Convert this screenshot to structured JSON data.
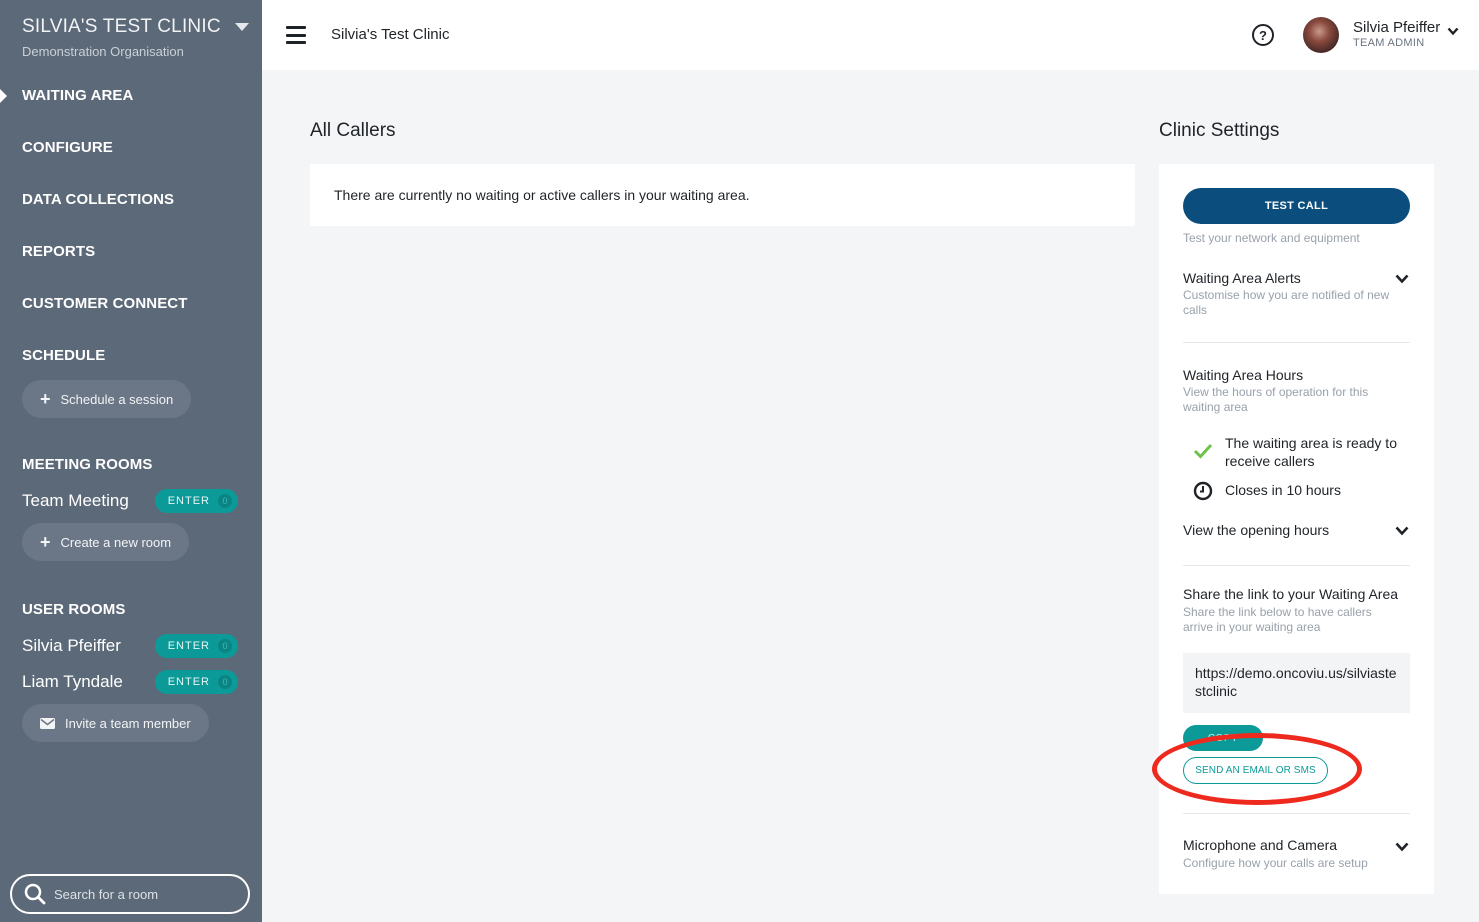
{
  "sidebar": {
    "org_name": "SILVIA'S TEST CLINIC",
    "org_subtitle": "Demonstration Organisation",
    "nav": {
      "waiting_area": "WAITING AREA",
      "configure": "CONFIGURE",
      "data_collections": "DATA COLLECTIONS",
      "reports": "REPORTS",
      "customer_connect": "CUSTOMER CONNECT",
      "schedule": "SCHEDULE"
    },
    "schedule_button": "Schedule a session",
    "meeting_rooms_heading": "MEETING ROOMS",
    "meeting_rooms": [
      {
        "name": "Team Meeting",
        "enter": "ENTER",
        "count": "0"
      }
    ],
    "create_room_button": "Create a new room",
    "user_rooms_heading": "USER ROOMS",
    "user_rooms": [
      {
        "name": "Silvia Pfeiffer",
        "enter": "ENTER",
        "count": "0"
      },
      {
        "name": "Liam Tyndale",
        "enter": "ENTER",
        "count": "0"
      }
    ],
    "invite_button": "Invite a team member",
    "search_placeholder": "Search for a room"
  },
  "header": {
    "title": "Silvia's Test Clinic",
    "help_icon": "question-circle-icon",
    "user_name": "Silvia Pfeiffer",
    "user_role": "TEAM ADMIN"
  },
  "main": {
    "callers_title": "All Callers",
    "callers_empty": "There are currently no waiting or active callers in your waiting area."
  },
  "settings": {
    "title": "Clinic Settings",
    "test_call_button": "TEST CALL",
    "test_call_sub": "Test your network and equipment",
    "alerts_title": "Waiting Area Alerts",
    "alerts_sub": "Customise how you are notified of new calls",
    "hours_title": "Waiting Area Hours",
    "hours_sub": "View the hours of operation for this waiting area",
    "status_ready": "The waiting area is ready to receive callers",
    "status_closes": "Closes in 10 hours",
    "opening_hours_toggle": "View the opening hours",
    "share_title": "Share the link to your Waiting Area",
    "share_sub": "Share the link below to have callers arrive in your waiting area",
    "share_link": "https://demo.oncoviu.us/silviastestclinic",
    "copy_button": "COPY",
    "email_button": "SEND AN EMAIL OR SMS",
    "mic_title": "Microphone and Camera",
    "mic_sub": "Configure how your calls are setup"
  },
  "colors": {
    "sidebar_bg": "#5c6978",
    "primary_button": "#0b4e7d",
    "accent_teal": "#0c9a99",
    "annotation_red": "#ee2a1f"
  }
}
